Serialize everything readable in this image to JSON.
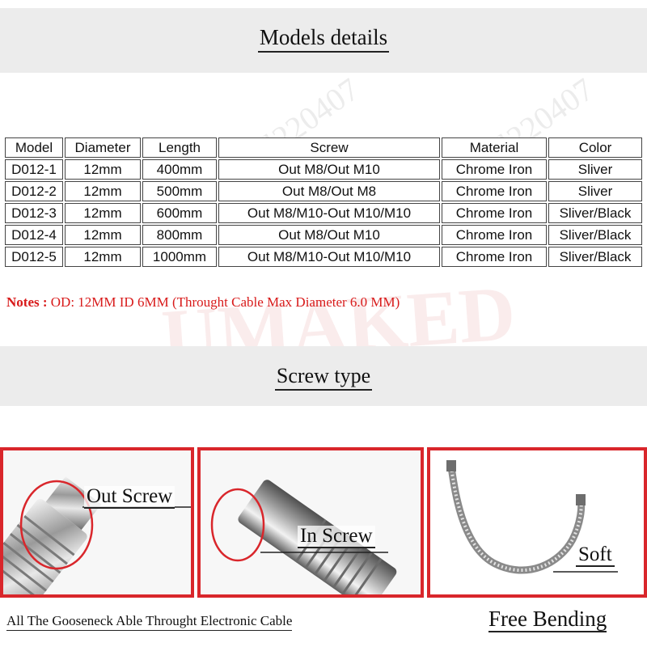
{
  "header": {
    "title": "Models details"
  },
  "table": {
    "columns": [
      "Model",
      "Diameter",
      "Length",
      "Screw",
      "Material",
      "Color"
    ],
    "rows": [
      [
        "D012-1",
        "12mm",
        "400mm",
        "Out M8/Out M10",
        "Chrome Iron",
        "Sliver"
      ],
      [
        "D012-2",
        "12mm",
        "500mm",
        "Out M8/Out M8",
        "Chrome Iron",
        "Sliver"
      ],
      [
        "D012-3",
        "12mm",
        "600mm",
        "Out M8/M10-Out M10/M10",
        "Chrome Iron",
        "Sliver/Black"
      ],
      [
        "D012-4",
        "12mm",
        "800mm",
        "Out M8/Out M10",
        "Chrome Iron",
        "Sliver/Black"
      ],
      [
        "D012-5",
        "12mm",
        "1000mm",
        "Out M8/M10-Out M10/M10",
        "Chrome Iron",
        "Sliver/Black"
      ]
    ]
  },
  "notes": {
    "label": "Notes :",
    "text": "OD: 12MM ID 6MM (Throught Cable Max Diameter  6.0 MM)"
  },
  "section2": {
    "title": "Screw type"
  },
  "photos": [
    {
      "label": "Out Screw"
    },
    {
      "label": "In Screw"
    },
    {
      "label": "Soft"
    }
  ],
  "footer": {
    "caption": "All The Gooseneck Able Throught Electronic Cable",
    "free_bending": "Free Bending"
  },
  "watermark": {
    "brand": "UMAKED",
    "store": "l220407"
  },
  "colors": {
    "accent_red": "#d9262b",
    "notes_red": "#d81a1a",
    "band_gray": "#ececec"
  }
}
